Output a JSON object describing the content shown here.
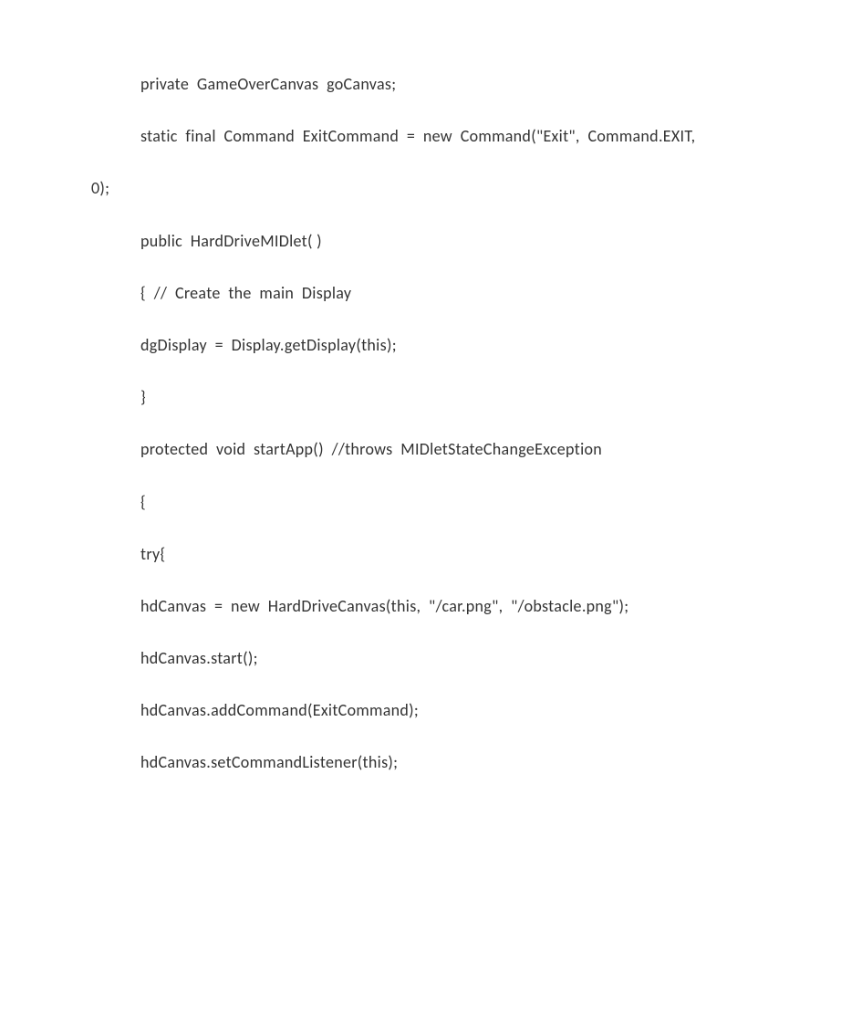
{
  "code": {
    "lines": [
      {
        "text": "private  GameOverCanvas  goCanvas;",
        "indent": true
      },
      {
        "text": "static  final  Command  ExitCommand  =  new  Command(\"Exit\",  Command.EXIT,",
        "indent": true
      },
      {
        "text": "0);",
        "indent": false
      },
      {
        "text": "public  HardDriveMIDlet( )",
        "indent": true
      },
      {
        "text": "{  //  Create  the  main  Display",
        "indent": true
      },
      {
        "text": "dgDisplay  =  Display.getDisplay(this);",
        "indent": true
      },
      {
        "text": "}",
        "indent": true
      },
      {
        "text": "protected  void  startApp()  //throws  MIDletStateChangeException",
        "indent": true
      },
      {
        "text": "{",
        "indent": true
      },
      {
        "text": "try{",
        "indent": true
      },
      {
        "text": "hdCanvas  =  new  HardDriveCanvas(this,  \"/car.png\",  \"/obstacle.png\");",
        "indent": true
      },
      {
        "text": "hdCanvas.start();",
        "indent": true
      },
      {
        "text": "hdCanvas.addCommand(ExitCommand);",
        "indent": true
      },
      {
        "text": "hdCanvas.setCommandListener(this);",
        "indent": true
      }
    ]
  }
}
